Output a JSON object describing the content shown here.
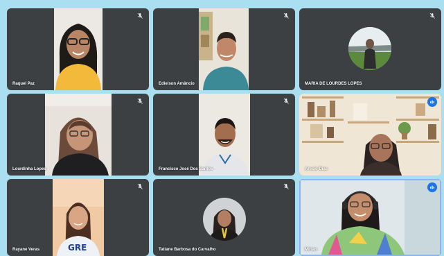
{
  "participants": [
    {
      "name": "Raquel Paz",
      "mic": "mic-muted-icon"
    },
    {
      "name": "Edielson Amâncio",
      "mic": "mic-muted-icon"
    },
    {
      "name": "MARIA DE LOURDES LOPES",
      "mic": "mic-muted-icon"
    },
    {
      "name": "Lourdinha Lopes",
      "mic": "mic-muted-icon"
    },
    {
      "name": "Francisco José Dos Santos",
      "mic": "mic-muted-icon"
    },
    {
      "name": "Arecio Dias",
      "mic": "speaking-indicator-icon"
    },
    {
      "name": "Rayane Veras",
      "mic": "mic-muted-icon"
    },
    {
      "name": "Tatiane Barbosa do Carvalho",
      "mic": "mic-muted-icon"
    },
    {
      "name": "Mirian",
      "mic": "speaking-indicator-icon"
    }
  ],
  "colors": {
    "background": "#a9dff1",
    "tile": "#3c4043",
    "active_speaker": "#1a73e8"
  },
  "shirt_text": "GRE"
}
